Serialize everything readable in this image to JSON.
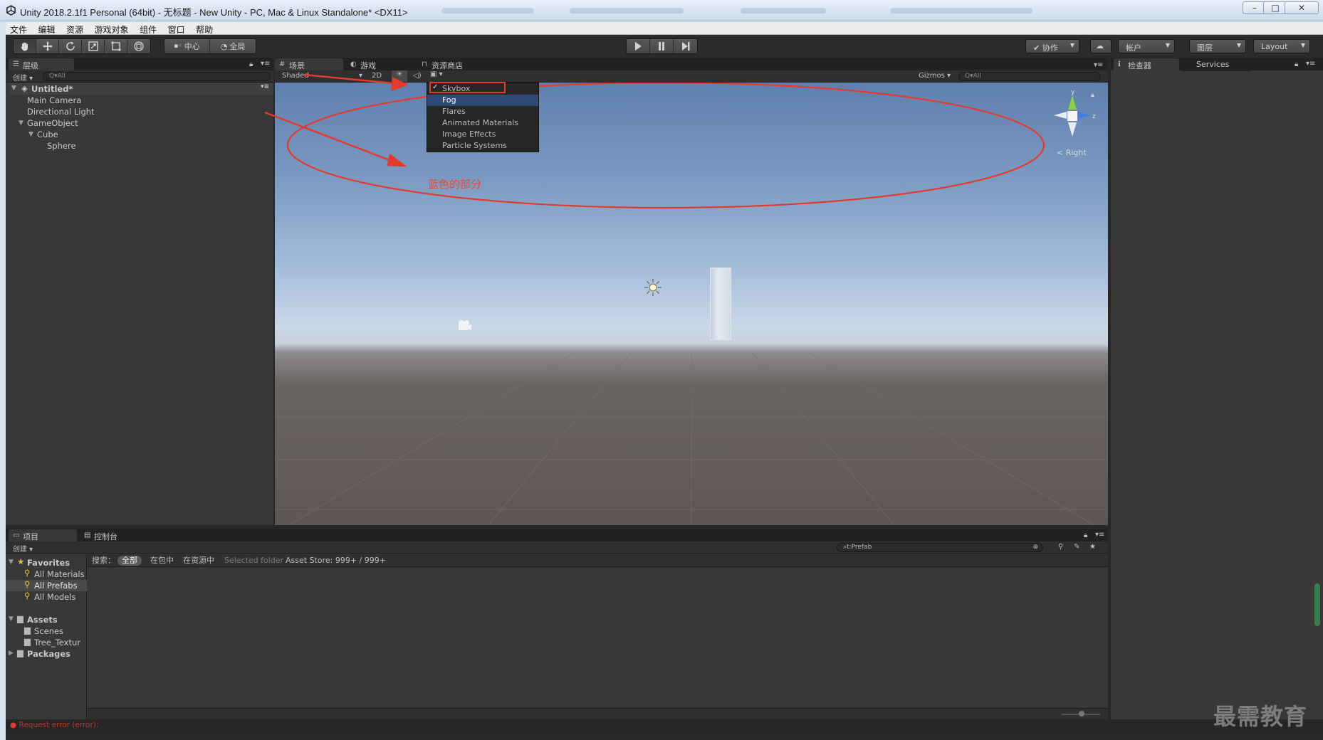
{
  "window": {
    "title": "Unity 2018.2.1f1 Personal (64bit) - 无标题 - New Unity - PC, Mac & Linux Standalone* <DX11>",
    "minimize": "–",
    "maximize": "□",
    "close": "✕"
  },
  "menubar": [
    "文件",
    "编辑",
    "资源",
    "游戏对象",
    "组件",
    "窗口",
    "帮助"
  ],
  "toolbar": {
    "pivot_label": "中心",
    "space_label": "全局",
    "collab_label": "协作",
    "account_label": "帐户",
    "layers_label": "图层",
    "layout_label": "Layout"
  },
  "hierarchy": {
    "tab_label": "层级",
    "create_label": "创建",
    "search_placeholder": "Q▾All",
    "scene_name": "Untitled*",
    "items": [
      {
        "label": "Main Camera",
        "depth": 1
      },
      {
        "label": "Directional Light",
        "depth": 1
      },
      {
        "label": "GameObject",
        "depth": 1,
        "expanded": true
      },
      {
        "label": "Cube",
        "depth": 2,
        "expanded": true
      },
      {
        "label": "Sphere",
        "depth": 3
      }
    ]
  },
  "scene_tabs": [
    {
      "label": "场景",
      "icon": "grid-icon",
      "selected": true
    },
    {
      "label": "游戏",
      "icon": "pacman-icon",
      "selected": false
    },
    {
      "label": "资源商店",
      "icon": "bag-icon",
      "selected": false
    }
  ],
  "scene_toolbar": {
    "shading_mode": "Shaded",
    "mode_2d": "2D",
    "gizmos_label": "Gizmos",
    "search_placeholder": "Q▾All"
  },
  "effects_menu": {
    "items": [
      {
        "label": "Skybox",
        "checked": true,
        "highlighted": false
      },
      {
        "label": "Fog",
        "checked": false,
        "highlighted": true
      },
      {
        "label": "Flares",
        "checked": false,
        "highlighted": false
      },
      {
        "label": "Animated Materials",
        "checked": false,
        "highlighted": false
      },
      {
        "label": "Image Effects",
        "checked": false,
        "highlighted": false
      },
      {
        "label": "Particle Systems",
        "checked": false,
        "highlighted": false
      }
    ]
  },
  "orientation_gizmo": {
    "y": "y",
    "z": "z",
    "view_label": "Right"
  },
  "annotation": {
    "text": "蓝色的部分",
    "color": "#e54b3c"
  },
  "inspector": {
    "tab_label": "检查器",
    "services_label": "Services"
  },
  "project": {
    "tab_label": "项目",
    "console_tab_label": "控制台",
    "create_label": "创建",
    "search_value": "t:Prefab",
    "favorites_label": "Favorites",
    "favorites": [
      "All Materials",
      "All Prefabs",
      "All Models"
    ],
    "selected_favorite": "All Prefabs",
    "assets_label": "Assets",
    "assets": [
      "Scenes",
      "Tree_Textur"
    ],
    "packages_label": "Packages",
    "filter": {
      "search_label": "搜索：",
      "all": "全部",
      "in_packages": "在包中",
      "in_assets": "在资源中",
      "selected_folder": "Selected folder",
      "asset_store": "Asset Store: 999+ / 999+"
    }
  },
  "status": {
    "error": "Request error (error):"
  },
  "watermark": "最需教育",
  "colors": {
    "accent_red": "#e54b3c",
    "selection_blue": "#2f4a74",
    "panel": "#383838"
  }
}
